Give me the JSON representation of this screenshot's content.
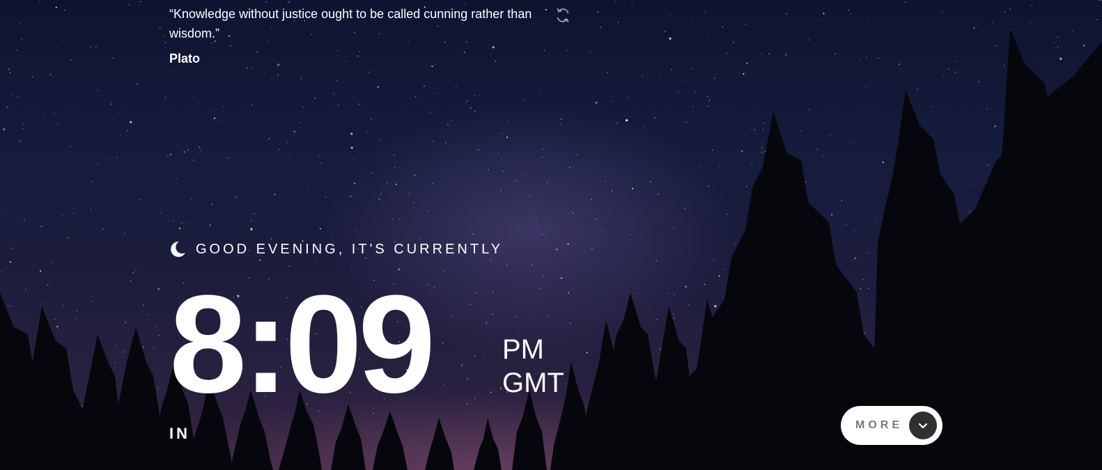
{
  "quote": {
    "text": "“Knowledge without justice ought to be called cunning rather than wisdom.”",
    "author": "Plato",
    "refresh_icon": "refresh-icon"
  },
  "greeting": {
    "icon": "moon-icon",
    "text": "GOOD EVENING, IT'S CURRENTLY"
  },
  "clock": {
    "time": "8:09",
    "meridiem": "PM",
    "timezone": "GMT"
  },
  "location": {
    "text": "IN"
  },
  "more_button": {
    "label": "MORE",
    "icon": "chevron-down-icon"
  },
  "colors": {
    "text": "#ffffff",
    "button_bg": "#ffffff",
    "button_label": "#7a7a7a",
    "button_circle": "#303030"
  }
}
